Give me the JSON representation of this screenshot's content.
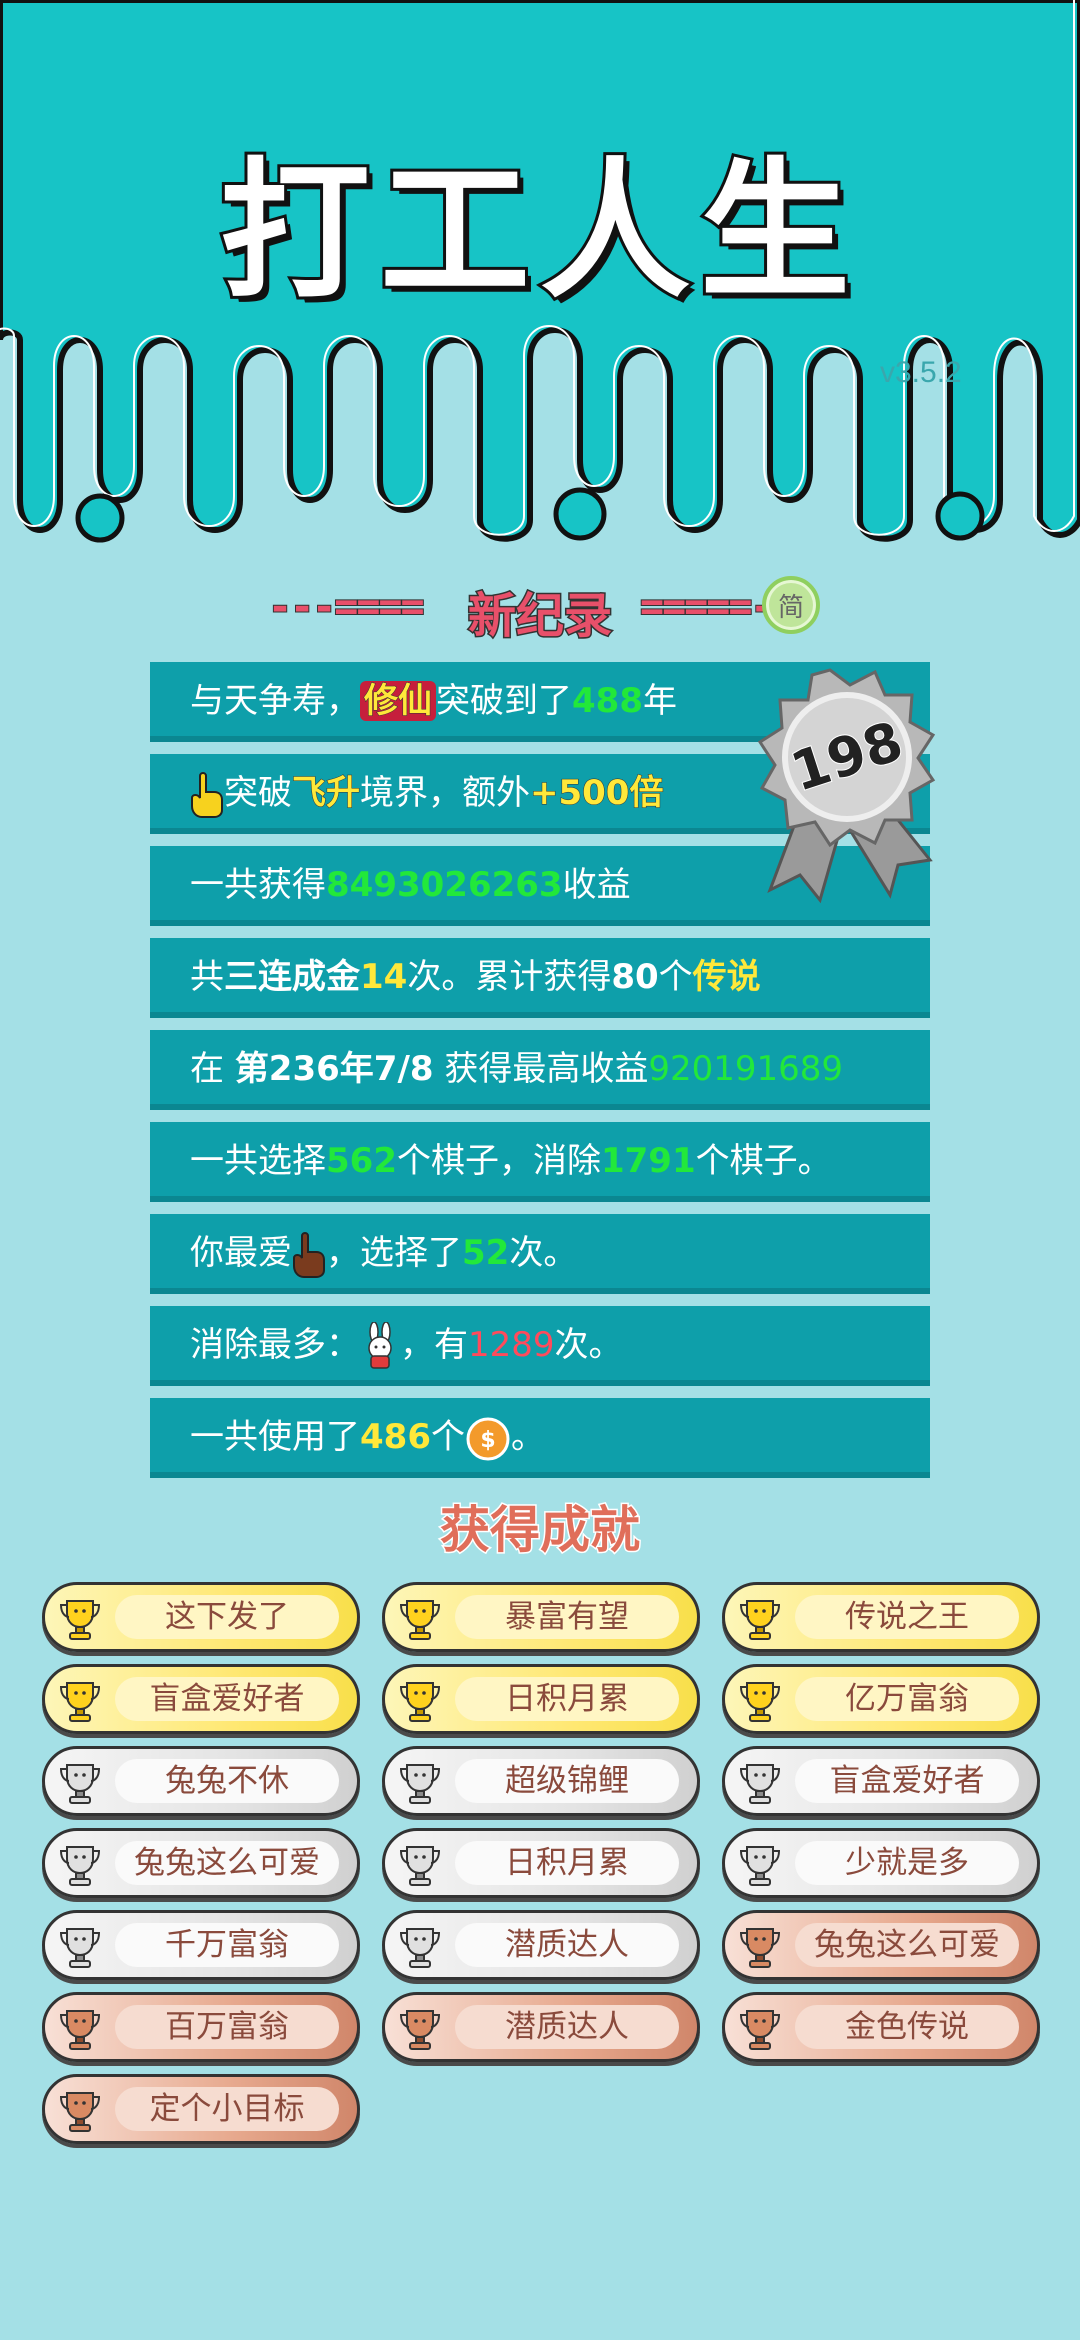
{
  "header": {
    "title": "打工人生",
    "version": "v3.5.2"
  },
  "record": {
    "left_dashes": "---====",
    "title": "新纪录",
    "right_dashes": "=====-",
    "lang_button": "简",
    "medal_number": "198"
  },
  "stats": [
    {
      "parts": [
        "与天争寿，",
        "修仙",
        "突破到了",
        "488",
        "年"
      ]
    },
    {
      "parts": [
        "突破",
        "飞升",
        "境界，额外",
        "+500倍"
      ]
    },
    {
      "parts": [
        "一共获得",
        "8493026263",
        "收益"
      ]
    },
    {
      "parts": [
        "共",
        "三连成金",
        "14",
        "次。累计获得",
        "80",
        "个",
        "传说"
      ]
    },
    {
      "parts": [
        "在 ",
        "第236年7/8",
        " 获得最高收益",
        "920191689"
      ]
    },
    {
      "parts": [
        "一共选择",
        "562",
        "个棋子，消除",
        "1791",
        "个棋子。"
      ]
    },
    {
      "parts": [
        "你最爱",
        "，选择了",
        "52",
        "次。"
      ]
    },
    {
      "parts": [
        "消除最多：",
        "，有",
        "1289",
        "次。"
      ]
    },
    {
      "parts": [
        "一共使用了",
        "486",
        "个",
        "。"
      ]
    }
  ],
  "icons": {
    "hand_yellow": "pointing-hand-icon",
    "hand_brown": "pointing-hand-brown-icon",
    "rabbit": "rabbit-icon",
    "coin": "coin-icon",
    "trophy": "trophy-icon"
  },
  "achievements_title": "获得成就",
  "achievements": [
    {
      "label": "这下发了",
      "tier": "gold"
    },
    {
      "label": "暴富有望",
      "tier": "gold"
    },
    {
      "label": "传说之王",
      "tier": "gold"
    },
    {
      "label": "盲盒爱好者",
      "tier": "gold"
    },
    {
      "label": "日积月累",
      "tier": "gold"
    },
    {
      "label": "亿万富翁",
      "tier": "gold"
    },
    {
      "label": "兔兔不休",
      "tier": "silver"
    },
    {
      "label": "超级锦鲤",
      "tier": "silver"
    },
    {
      "label": "盲盒爱好者",
      "tier": "silver"
    },
    {
      "label": "兔兔这么可爱",
      "tier": "silver"
    },
    {
      "label": "日积月累",
      "tier": "silver"
    },
    {
      "label": "少就是多",
      "tier": "silver"
    },
    {
      "label": "千万富翁",
      "tier": "silver"
    },
    {
      "label": "潜质达人",
      "tier": "silver"
    },
    {
      "label": "兔兔这么可爱",
      "tier": "bronze"
    },
    {
      "label": "百万富翁",
      "tier": "bronze"
    },
    {
      "label": "潜质达人",
      "tier": "bronze"
    },
    {
      "label": "金色传说",
      "tier": "bronze"
    },
    {
      "label": "定个小目标",
      "tier": "bronze"
    }
  ],
  "colors": {
    "background": "#a4e0e6",
    "header": "#17c4c6",
    "row": "#0e9faa",
    "green": "#22e83a",
    "yellow": "#ffe83a",
    "red": "#ff4b5c",
    "pink": "#e8506a"
  }
}
